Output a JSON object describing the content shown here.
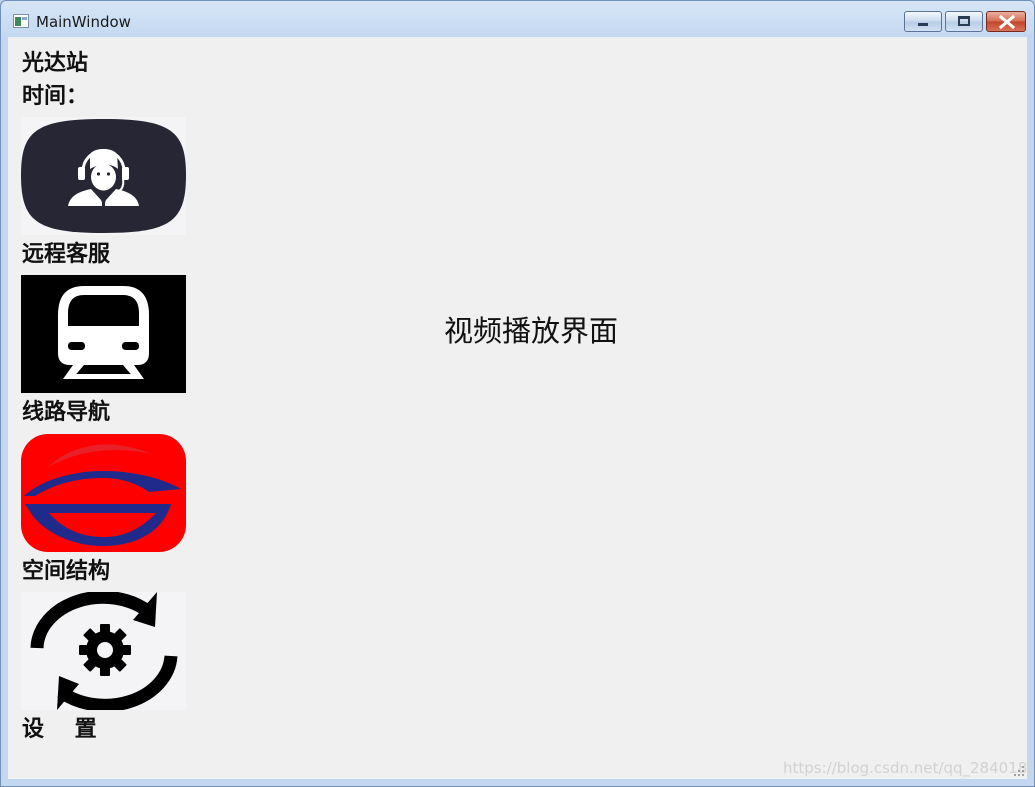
{
  "window": {
    "title": "MainWindow"
  },
  "station": {
    "name": "光达站",
    "time_label": "时间："
  },
  "menu": [
    {
      "label": "远程客服",
      "icon": "customer-service-icon"
    },
    {
      "label": "线路导航",
      "icon": "metro-train-icon"
    },
    {
      "label": "空间结构",
      "icon": "metro-logo-icon"
    },
    {
      "label": "设    置",
      "icon": "settings-sync-icon"
    }
  ],
  "main": {
    "video_placeholder": "视频播放界面"
  },
  "watermark": "https://blog.csdn.net/qq_28401858",
  "colors": {
    "client_bg": "#f0f0f0",
    "service_tile": "#262634",
    "train_tile": "#000000",
    "logo_red": "#ff0000",
    "logo_blue": "#1f2a8a"
  }
}
